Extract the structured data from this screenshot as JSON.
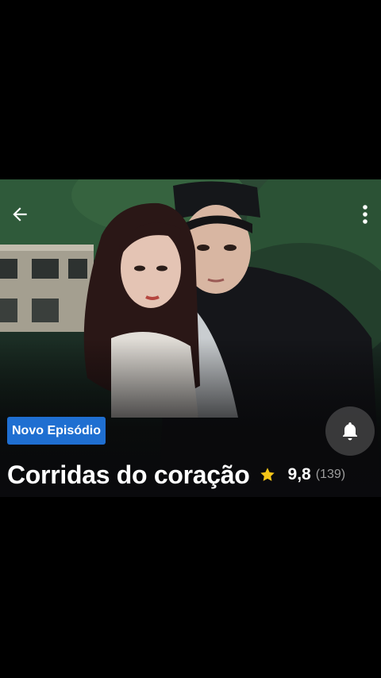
{
  "hero": {
    "badge_label": "Novo Episódio",
    "title": "Corridas do coração",
    "rating": "9,8",
    "rating_count": "(139)"
  },
  "icons": {
    "back": "arrow-left-icon",
    "more": "vertical-dots-icon",
    "bell": "bell-icon",
    "star": "star-icon"
  },
  "colors": {
    "background": "#000000",
    "badge": "#1f6fd1",
    "star": "#f5c518",
    "text": "#ffffff",
    "count_text": "#9d9d9d"
  }
}
